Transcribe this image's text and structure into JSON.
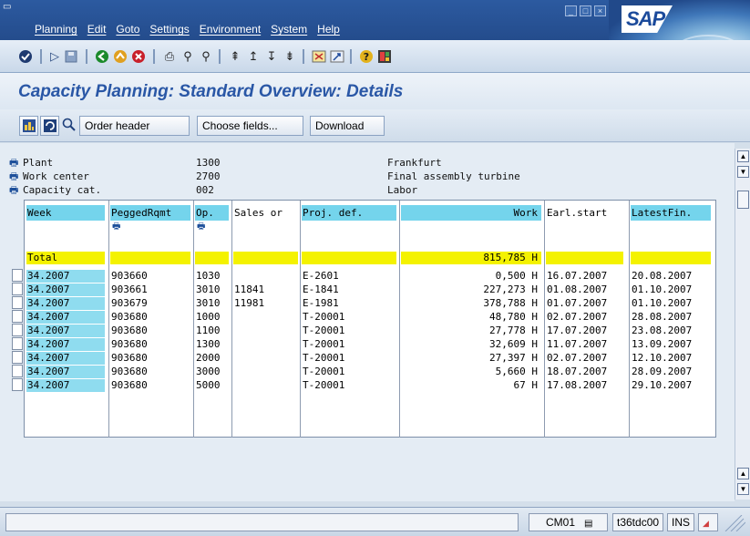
{
  "menu": [
    "Planning",
    "Edit",
    "Goto",
    "Settings",
    "Environment",
    "System",
    "Help"
  ],
  "logo": "SAP",
  "title": "Capacity Planning: Standard Overview: Details",
  "app_toolbar": {
    "order_header": "Order header",
    "choose_fields": "Choose fields...",
    "download": "Download"
  },
  "header_fields": [
    {
      "label": "Plant",
      "value": "1300",
      "desc": "Frankfurt"
    },
    {
      "label": "Work center",
      "value": "2700",
      "desc": "Final assembly turbine"
    },
    {
      "label": "Capacity cat.",
      "value": "002",
      "desc": "Labor"
    }
  ],
  "table": {
    "columns": [
      "Week",
      "PeggedRqmt",
      "Op.",
      "Sales or",
      "Proj. def.",
      "Work",
      "Earl.start",
      "LatestFin."
    ],
    "total": {
      "label": "Total",
      "work": "815,785 H"
    },
    "rows": [
      [
        "34.2007",
        "903660",
        "1030",
        "",
        "E-2601",
        "0,500 H",
        "16.07.2007",
        "20.08.2007"
      ],
      [
        "34.2007",
        "903661",
        "3010",
        "11841",
        "E-1841",
        "227,273 H",
        "01.08.2007",
        "01.10.2007"
      ],
      [
        "34.2007",
        "903679",
        "3010",
        "11981",
        "E-1981",
        "378,788 H",
        "01.07.2007",
        "01.10.2007"
      ],
      [
        "34.2007",
        "903680",
        "1000",
        "",
        "T-20001",
        "48,780 H",
        "02.07.2007",
        "28.08.2007"
      ],
      [
        "34.2007",
        "903680",
        "1100",
        "",
        "T-20001",
        "27,778 H",
        "17.07.2007",
        "23.08.2007"
      ],
      [
        "34.2007",
        "903680",
        "1300",
        "",
        "T-20001",
        "32,609 H",
        "11.07.2007",
        "13.09.2007"
      ],
      [
        "34.2007",
        "903680",
        "2000",
        "",
        "T-20001",
        "27,397 H",
        "02.07.2007",
        "12.10.2007"
      ],
      [
        "34.2007",
        "903680",
        "3000",
        "",
        "T-20001",
        "5,660 H",
        "18.07.2007",
        "28.09.2007"
      ],
      [
        "34.2007",
        "903680",
        "5000",
        "",
        "T-20001",
        "67 H",
        "17.08.2007",
        "29.10.2007"
      ]
    ]
  },
  "status": {
    "transaction": "CM01",
    "server": "t36tdc00",
    "mode": "INS"
  }
}
